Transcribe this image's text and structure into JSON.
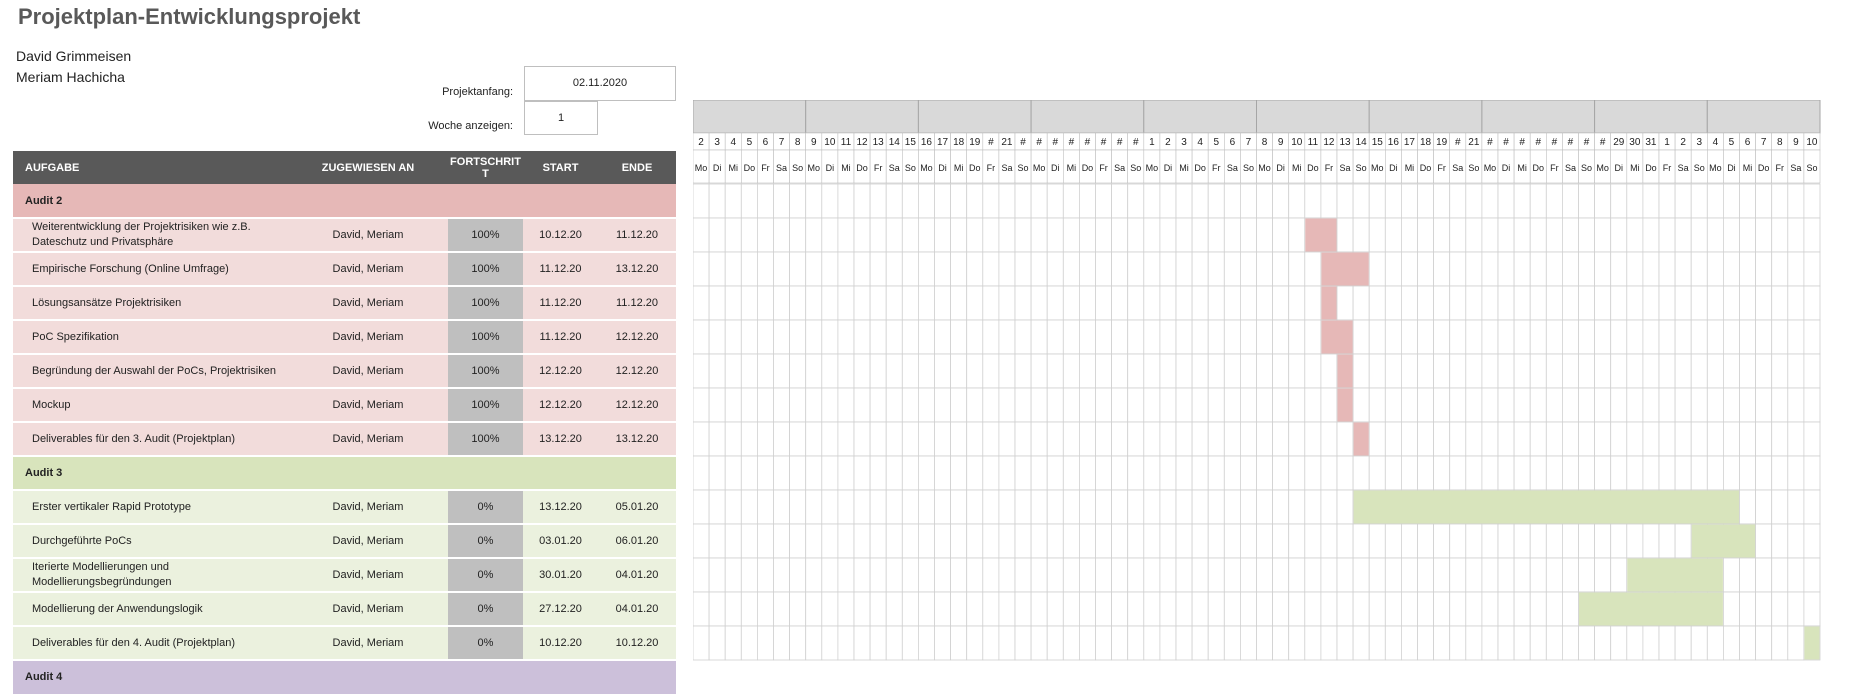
{
  "title": "Projektplan-Entwicklungsprojekt",
  "authors": [
    "David Grimmeisen",
    "Meriam Hachicha"
  ],
  "project_start": {
    "label": "Projektanfang:",
    "value": "02.11.2020"
  },
  "week_display": {
    "label": "Woche anzeigen:",
    "value": "1"
  },
  "columns": {
    "task": "AUFGABE",
    "assigned": "ZUGEWIESEN AN",
    "progress": "FORTSCHRITT",
    "start": "START",
    "end": "ENDE"
  },
  "sections": [
    {
      "name": "Audit 2",
      "color": "#e6b8b7",
      "row_color": "#f2dcdb",
      "bar_color": "#e6b8b7",
      "tasks": [
        {
          "task": "Weiterentwicklung der Projektrisiken wie z.B. Dateschutz und Privatsphäre",
          "assigned": "David, Meriam",
          "progress": "100%",
          "start": "10.12.20",
          "end": "11.12.20"
        },
        {
          "task": "Empirische Forschung (Online Umfrage)",
          "assigned": "David, Meriam",
          "progress": "100%",
          "start": "11.12.20",
          "end": "13.12.20"
        },
        {
          "task": "Lösungsansätze Projektrisiken",
          "assigned": "David, Meriam",
          "progress": "100%",
          "start": "11.12.20",
          "end": "11.12.20"
        },
        {
          "task": "PoC Spezifikation",
          "assigned": "David, Meriam",
          "progress": "100%",
          "start": "11.12.20",
          "end": "12.12.20"
        },
        {
          "task": "Begründung der Auswahl der PoCs, Projektrisiken",
          "assigned": "David, Meriam",
          "progress": "100%",
          "start": "12.12.20",
          "end": "12.12.20"
        },
        {
          "task": "Mockup",
          "assigned": "David, Meriam",
          "progress": "100%",
          "start": "12.12.20",
          "end": "12.12.20"
        },
        {
          "task": "Deliverables für den 3. Audit (Projektplan)",
          "assigned": "David, Meriam",
          "progress": "100%",
          "start": "13.12.20",
          "end": "13.12.20"
        }
      ]
    },
    {
      "name": "Audit 3",
      "color": "#d8e4bc",
      "row_color": "#ebf1de",
      "bar_color": "#d8e4bc",
      "tasks": [
        {
          "task": "Erster vertikaler Rapid Prototype",
          "assigned": "David, Meriam",
          "progress": "0%",
          "start": "13.12.20",
          "end": "05.01.20"
        },
        {
          "task": "Durchgeführte PoCs",
          "assigned": "David, Meriam",
          "progress": "0%",
          "start": "03.01.20",
          "end": "06.01.20"
        },
        {
          "task": "Iterierte Modellierungen und Modellierungsbegründungen",
          "assigned": "David, Meriam",
          "progress": "0%",
          "start": "30.01.20",
          "end": "04.01.20"
        },
        {
          "task": "Modellierung der Anwendungslogik",
          "assigned": "David, Meriam",
          "progress": "0%",
          "start": "27.12.20",
          "end": "04.01.20"
        },
        {
          "task": "Deliverables für den 4. Audit (Projektplan)",
          "assigned": "David, Meriam",
          "progress": "0%",
          "start": "10.12.20",
          "end": "10.12.20"
        }
      ]
    },
    {
      "name": "Audit 4",
      "color": "#ccc0da",
      "row_color": "#e4dfec",
      "bar_color": "#ccc0da",
      "tasks": []
    }
  ],
  "timeline": {
    "day_numbers": [
      "2",
      "3",
      "4",
      "5",
      "6",
      "7",
      "8",
      "9",
      "10",
      "11",
      "12",
      "13",
      "14",
      "15",
      "16",
      "17",
      "18",
      "19",
      "#",
      "21",
      "#",
      "#",
      "#",
      "#",
      "#",
      "#",
      "#",
      "#",
      "1",
      "2",
      "3",
      "4",
      "5",
      "6",
      "7",
      "8",
      "9",
      "10",
      "11",
      "12",
      "13",
      "14",
      "15",
      "16",
      "17",
      "18",
      "19",
      "#",
      "21",
      "#",
      "#",
      "#",
      "#",
      "#",
      "#",
      "#",
      "#",
      "29",
      "30",
      "31",
      "1",
      "2",
      "3",
      "4",
      "5",
      "6",
      "7",
      "8",
      "9",
      "10"
    ],
    "weekdays": [
      "Mo",
      "Di",
      "Mi",
      "Do",
      "Fr",
      "Sa",
      "So",
      "Mo",
      "Di",
      "Mi",
      "Do",
      "Fr",
      "Sa",
      "So",
      "Mo",
      "Di",
      "Mi",
      "Do",
      "Fr",
      "Sa",
      "So",
      "Mo",
      "Di",
      "Mi",
      "Do",
      "Fr",
      "Sa",
      "So",
      "Mo",
      "Di",
      "Mi",
      "Do",
      "Fr",
      "Sa",
      "So",
      "Mo",
      "Di",
      "Mi",
      "Do",
      "Fr",
      "Sa",
      "So",
      "Mo",
      "Di",
      "Mi",
      "Do",
      "Fr",
      "Sa",
      "So",
      "Mo",
      "Di",
      "Mi",
      "Do",
      "Fr",
      "Sa",
      "So",
      "Mo",
      "Di",
      "Mi",
      "Do",
      "Fr",
      "Sa",
      "So",
      "Mo",
      "Di",
      "Mi",
      "Do",
      "Fr",
      "Sa",
      "So"
    ],
    "bars": [
      {
        "row": 1,
        "from": 38,
        "to": 39,
        "color": "#e6b8b7"
      },
      {
        "row": 2,
        "from": 39,
        "to": 41,
        "color": "#e6b8b7"
      },
      {
        "row": 3,
        "from": 39,
        "to": 39,
        "color": "#e6b8b7"
      },
      {
        "row": 4,
        "from": 39,
        "to": 40,
        "color": "#e6b8b7"
      },
      {
        "row": 5,
        "from": 40,
        "to": 40,
        "color": "#e6b8b7"
      },
      {
        "row": 6,
        "from": 40,
        "to": 40,
        "color": "#e6b8b7"
      },
      {
        "row": 7,
        "from": 41,
        "to": 41,
        "color": "#e6b8b7"
      },
      {
        "row": 9,
        "from": 41,
        "to": 64,
        "color": "#d8e4bc"
      },
      {
        "row": 10,
        "from": 62,
        "to": 65,
        "color": "#d8e4bc"
      },
      {
        "row": 11,
        "from": 58,
        "to": 63,
        "color": "#d8e4bc"
      },
      {
        "row": 12,
        "from": 55,
        "to": 63,
        "color": "#d8e4bc"
      },
      {
        "row": 13,
        "from": 69,
        "to": 69,
        "color": "#d8e4bc"
      }
    ]
  }
}
